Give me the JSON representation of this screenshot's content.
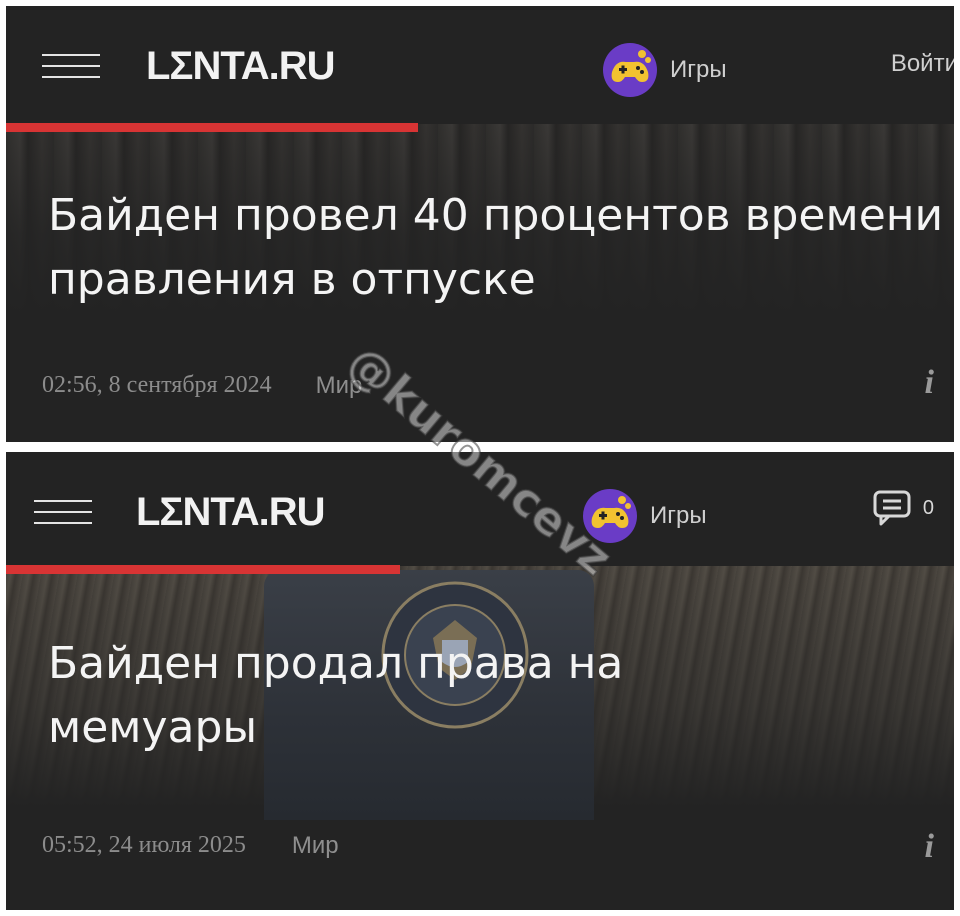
{
  "screens": [
    {
      "header": {
        "logo": "LΣNTA.RU",
        "games_label": "Игры",
        "login_label": "Войти"
      },
      "article": {
        "title": "Байден провел 40 процентов времени правления в отпуске",
        "datetime": "02:56, 8 сентября 2024",
        "rubric": "Мир",
        "info_icon": "i"
      }
    },
    {
      "header": {
        "logo": "LΣNTA.RU",
        "games_label": "Игры",
        "comments_count": "0"
      },
      "article": {
        "title": "Байден продал права на мемуары",
        "datetime": "05:52, 24 июля 2025",
        "rubric": "Мир",
        "info_icon": "i"
      }
    }
  ],
  "watermark": "@kuromcevz",
  "colors": {
    "background": "#232323",
    "accent_red": "#d83434",
    "games_icon": "#f2c230",
    "games_icon_bg": "#6a3cc6"
  },
  "icons": [
    "menu-icon",
    "gamepad-icon",
    "comment-icon",
    "info-icon"
  ]
}
